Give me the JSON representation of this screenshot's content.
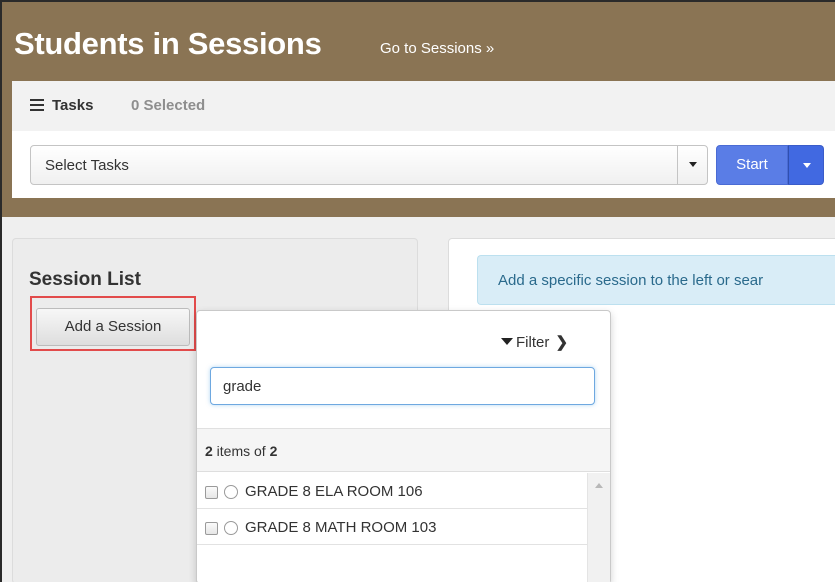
{
  "header": {
    "title": "Students in Sessions",
    "goto_link": "Go to Sessions »"
  },
  "tasks": {
    "label": "Tasks",
    "selected": "0 Selected",
    "select_placeholder": "Select Tasks",
    "start_label": "Start"
  },
  "session_list": {
    "title": "Session List",
    "add_button": "Add a Session"
  },
  "info": {
    "message": "Add a specific session to the left or sear"
  },
  "popup": {
    "filter_label": "Filter",
    "search_value": "grade",
    "count_num": "2",
    "count_mid": " items of ",
    "count_total": "2",
    "items": [
      {
        "label": "GRADE 8 ELA ROOM 106"
      },
      {
        "label": "GRADE 8 MATH ROOM 103"
      }
    ]
  },
  "colors": {
    "header_brown": "#8a7454",
    "start_blue": "#5a7de6",
    "highlight_red": "#e24b4b",
    "info_bg": "#d9edf7"
  }
}
